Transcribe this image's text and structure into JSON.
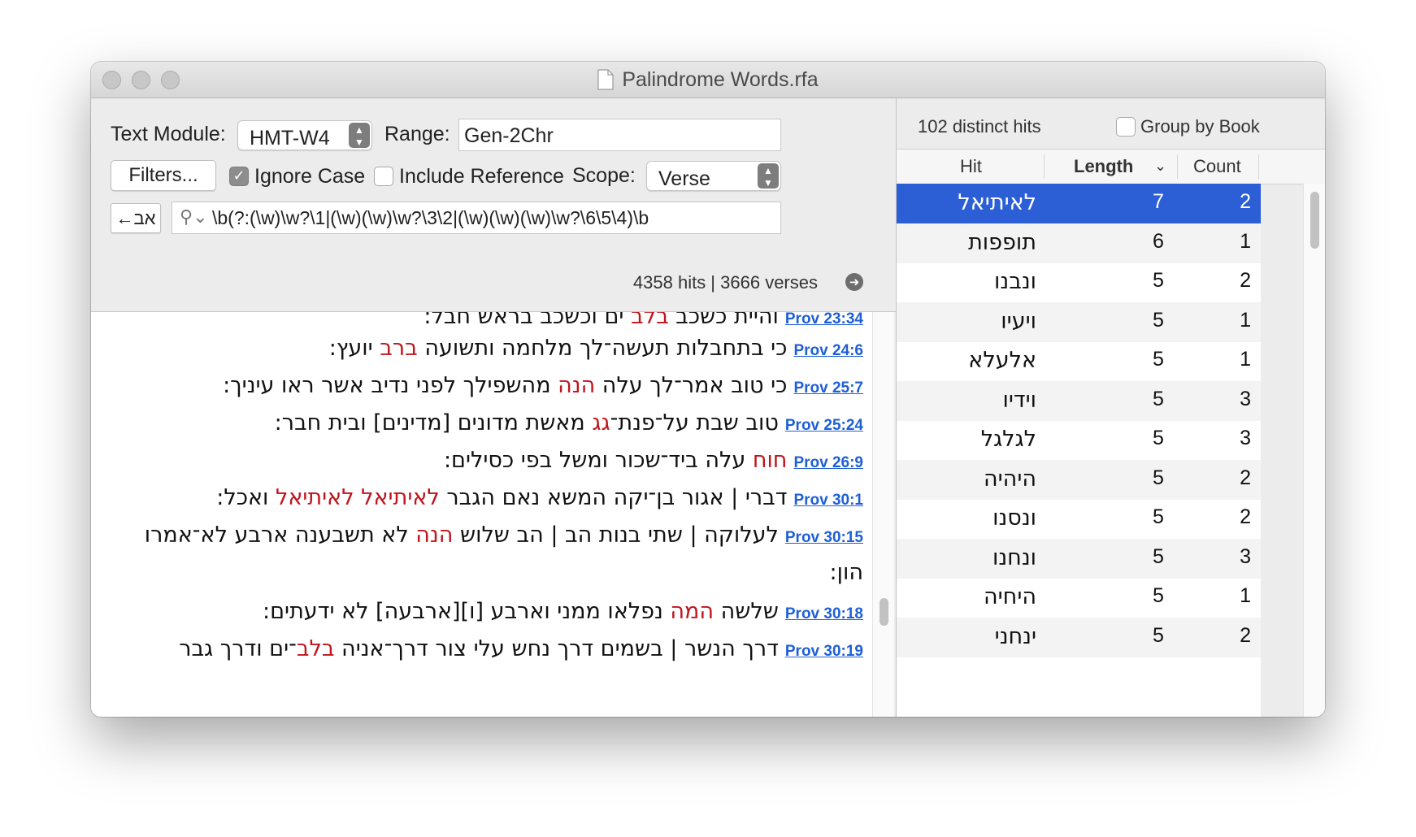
{
  "window": {
    "title": "Palindrome Words.rfa"
  },
  "toolbar": {
    "text_module_label": "Text Module:",
    "text_module_value": "HMT-W4",
    "range_label": "Range:",
    "range_value": "Gen-2Chr",
    "filters_label": "Filters...",
    "ignore_case_label": "Ignore Case",
    "ignore_case_checked": true,
    "include_reference_label": "Include Reference",
    "include_reference_checked": false,
    "scope_label": "Scope:",
    "scope_value": "Verse",
    "keyboard_label": "←אב",
    "search_query": "\\b(?:(\\w)\\w?\\1|(\\w)(\\w)\\w?\\3\\2|(\\w)(\\w)(\\w)\\w?\\6\\5\\4)\\b",
    "hits_summary": "4358 hits | 3666 verses"
  },
  "verses": [
    {
      "ref": "Prov 23:34",
      "segments": [
        {
          "t": "והי",
          "h": false
        },
        {
          "t": "ית כשכב ",
          "h": false
        },
        {
          "t": "בלב",
          "h": true
        },
        {
          "t": " ים וכשכב בראש חבל:",
          "h": false
        }
      ]
    },
    {
      "ref": "Prov 24:6",
      "segments": [
        {
          "t": "כי בתחבלות תעשה־לך מלחמה ותשועה ",
          "h": false
        },
        {
          "t": "ברב",
          "h": true
        },
        {
          "t": " יועץ:",
          "h": false
        }
      ]
    },
    {
      "ref": "Prov 25:7",
      "segments": [
        {
          "t": "כי טוב אמר־לך עלה ",
          "h": false
        },
        {
          "t": "הנה",
          "h": true
        },
        {
          "t": " מהשפילך לפני נדיב אשר ראו עיניך:",
          "h": false
        }
      ]
    },
    {
      "ref": "Prov 25:24",
      "segments": [
        {
          "t": "טוב שבת על־פנת־",
          "h": false
        },
        {
          "t": "גג",
          "h": true
        },
        {
          "t": " מאשת מדונים [מדינים] ובית חבר:",
          "h": false
        }
      ]
    },
    {
      "ref": "Prov 26:9",
      "segments": [
        {
          "t": "חוח",
          "h": true
        },
        {
          "t": " עלה ביד־שכור ומשל בפי כסילים:",
          "h": false
        }
      ]
    },
    {
      "ref": "Prov 30:1",
      "segments": [
        {
          "t": "דברי | אגור בן־יקה המשא נאם הגבר ",
          "h": false
        },
        {
          "t": "לאיתיאל לאיתיאל",
          "h": true
        },
        {
          "t": " ואכל:",
          "h": false
        }
      ]
    },
    {
      "ref": "Prov 30:15",
      "segments": [
        {
          "t": "לעלוקה | שתי בנות הב | הב שלוש ",
          "h": false
        },
        {
          "t": "הנה",
          "h": true
        },
        {
          "t": " לא תשבענה ארבע לא־אמרו",
          "h": false
        }
      ],
      "cont": "הון:"
    },
    {
      "ref": "Prov 30:18",
      "segments": [
        {
          "t": "שלשה ",
          "h": false
        },
        {
          "t": "המה",
          "h": true
        },
        {
          "t": " נפלאו ממני וארבע [ו][ארבעה] לא ידעתים:",
          "h": false
        }
      ]
    },
    {
      "ref": "Prov 30:19",
      "segments": [
        {
          "t": "דרך הנשר | בשמים דרך נחש עלי צור דרך־אניה ",
          "h": false
        },
        {
          "t": "בלב",
          "h": true
        },
        {
          "t": "־ים ודרך גבר",
          "h": false
        }
      ]
    }
  ],
  "right": {
    "distinct_hits": "102 distinct hits",
    "group_by_book_label": "Group by Book",
    "group_by_book_checked": false,
    "columns": {
      "hit": "Hit",
      "length": "Length",
      "count": "Count"
    },
    "rows": [
      {
        "hit": "לאיתיאל",
        "length": "7",
        "count": "2"
      },
      {
        "hit": "תופפות",
        "length": "6",
        "count": "1"
      },
      {
        "hit": "ונבנו",
        "length": "5",
        "count": "2"
      },
      {
        "hit": "ויעיו",
        "length": "5",
        "count": "1"
      },
      {
        "hit": "אלעלא",
        "length": "5",
        "count": "1"
      },
      {
        "hit": "וידיו",
        "length": "5",
        "count": "3"
      },
      {
        "hit": "לגלגל",
        "length": "5",
        "count": "3"
      },
      {
        "hit": "היהיה",
        "length": "5",
        "count": "2"
      },
      {
        "hit": "ונסנו",
        "length": "5",
        "count": "2"
      },
      {
        "hit": "ונחנו",
        "length": "5",
        "count": "3"
      },
      {
        "hit": "היחיה",
        "length": "5",
        "count": "1"
      },
      {
        "hit": "ינחני",
        "length": "5",
        "count": "2"
      }
    ]
  },
  "colors": {
    "highlight": "#c0151c",
    "link": "#1f5fd6",
    "selection": "#2c5fd6"
  }
}
